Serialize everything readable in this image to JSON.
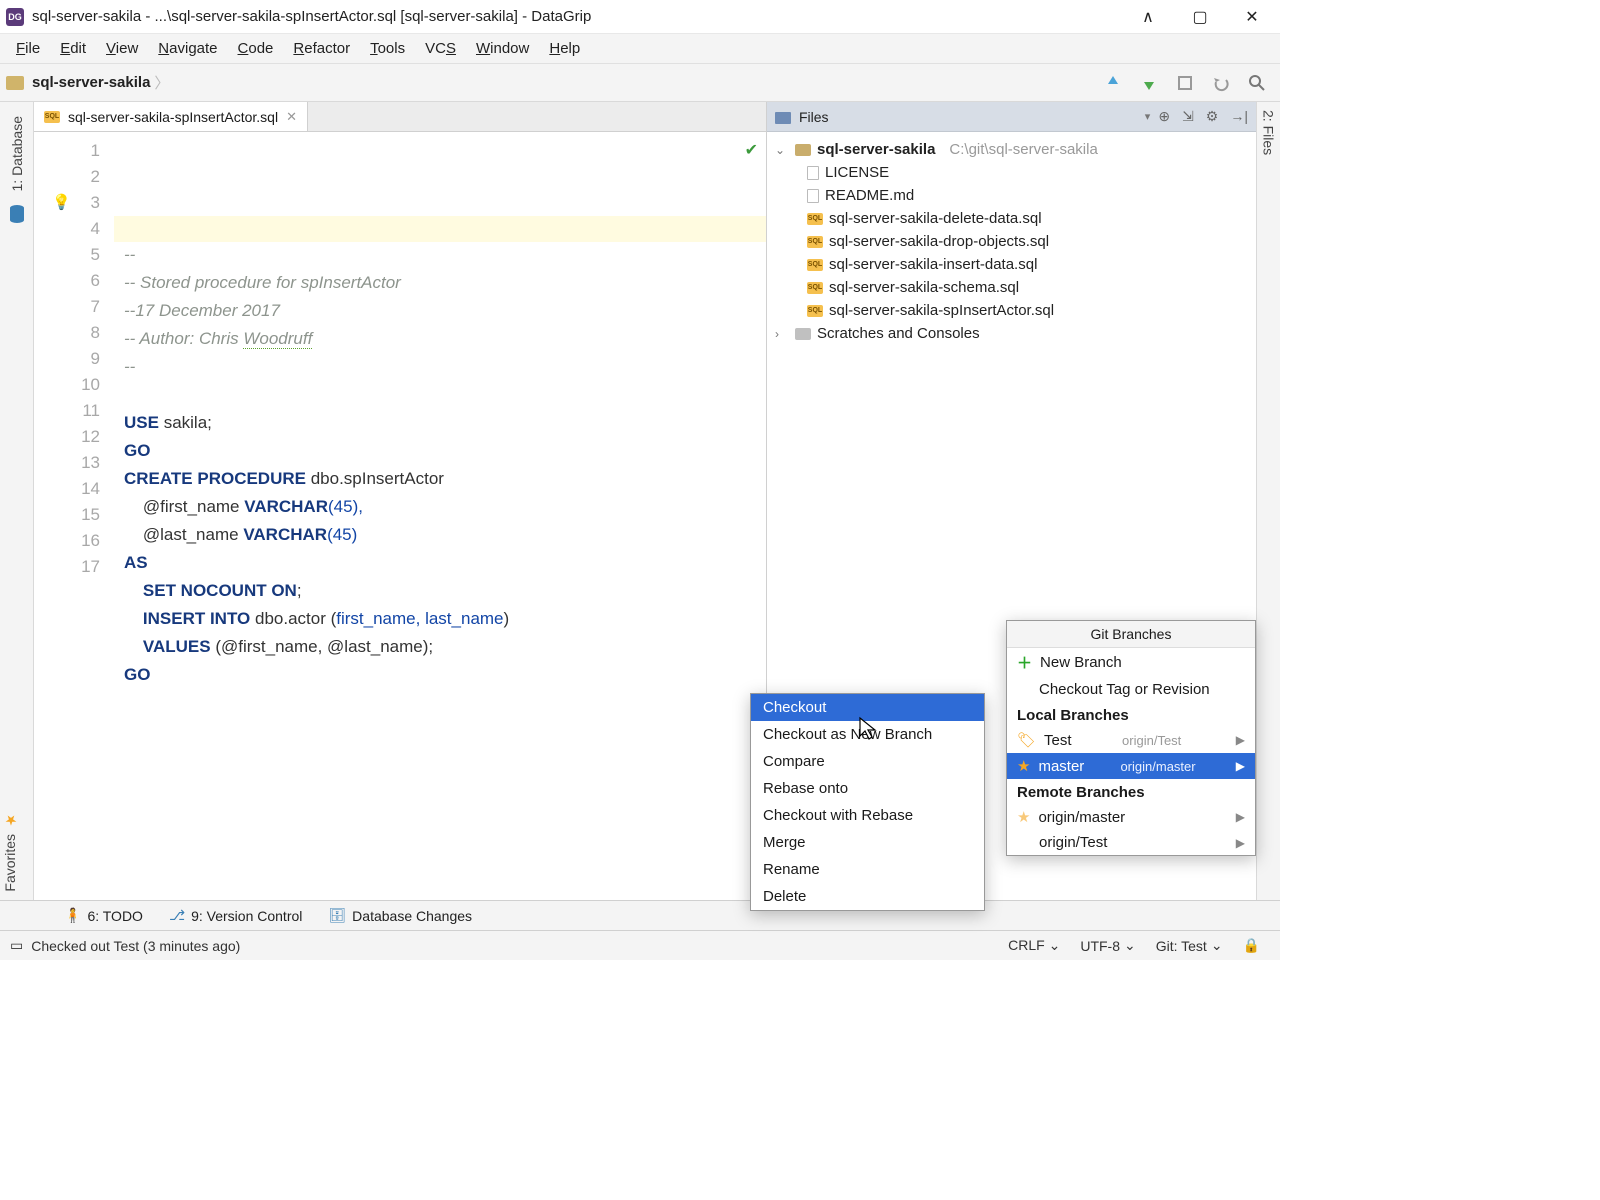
{
  "window": {
    "title": "sql-server-sakila - ...\\sql-server-sakila-spInsertActor.sql [sql-server-sakila] - DataGrip"
  },
  "menu": [
    "File",
    "Edit",
    "View",
    "Navigate",
    "Code",
    "Refactor",
    "Tools",
    "VCS",
    "Window",
    "Help"
  ],
  "breadcrumb": "sql-server-sakila",
  "tab": {
    "name": "sql-server-sakila-spInsertActor.sql"
  },
  "left_sidebar": {
    "database": "1: Database"
  },
  "right_sidebar": {
    "files": "2: Files"
  },
  "favorites": "Favorites",
  "editor": {
    "lines": [
      "1",
      "2",
      "3",
      "4",
      "5",
      "6",
      "7",
      "8",
      "9",
      "10",
      "11",
      "12",
      "13",
      "14",
      "15",
      "16",
      "17"
    ],
    "comment1": "--",
    "comment2": "-- Stored procedure for spInsertActor",
    "comment3_pre": "--",
    "comment3_date": "17 December 2017",
    "comment4_pre": "-- Author: Chris ",
    "comment4_typo": "Woodruff",
    "comment5": "--",
    "l7": {
      "use": "USE",
      "sakila": "sakila;",
      "go": "GO"
    },
    "l9": {
      "create": "CREATE PROCEDURE",
      "name": " dbo.spInsertActor"
    },
    "l10": {
      "p": "    @first_name ",
      "t": "VARCHAR",
      "n": "(45),"
    },
    "l11": {
      "p": "    @last_name ",
      "t": "VARCHAR",
      "n": "(45)"
    },
    "l12": "AS",
    "l13": {
      "set": "    SET NOCOUNT ON",
      ";": ";"
    },
    "l14": {
      "a": "    INSERT INTO",
      " b": " dbo.actor (",
      "c": "first_name, last_name",
      "d": ")"
    },
    "l15": {
      "a": "    VALUES",
      " b": " (@first_name, @last_name);"
    },
    "l16": "GO"
  },
  "files_panel": {
    "label": "Files",
    "root": "sql-server-sakila",
    "root_path": "C:\\git\\sql-server-sakila",
    "items": [
      {
        "icon": "file",
        "name": "LICENSE"
      },
      {
        "icon": "file",
        "name": "README.md"
      },
      {
        "icon": "sql",
        "name": "sql-server-sakila-delete-data.sql"
      },
      {
        "icon": "sql",
        "name": "sql-server-sakila-drop-objects.sql"
      },
      {
        "icon": "sql",
        "name": "sql-server-sakila-insert-data.sql"
      },
      {
        "icon": "sql",
        "name": "sql-server-sakila-schema.sql"
      },
      {
        "icon": "sql",
        "name": "sql-server-sakila-spInsertActor.sql"
      }
    ],
    "scratches": "Scratches and Consoles"
  },
  "bottom_tools": {
    "todo": "6: TODO",
    "vc": "9: Version Control",
    "dbc": "Database Changes"
  },
  "statusbar": {
    "msg": "Checked out Test (3 minutes ago)",
    "enc": "UTF-8",
    "git": "Git: Test"
  },
  "branches_popup": {
    "title": "Git Branches",
    "new_branch": "New Branch",
    "checkout_tag": "Checkout Tag or Revision",
    "local_head": "Local Branches",
    "local": [
      {
        "name": "Test",
        "remote": "origin/Test",
        "star": false
      },
      {
        "name": "master",
        "remote": "origin/master",
        "star": true,
        "selected": true
      }
    ],
    "remote_head": "Remote Branches",
    "remote": [
      {
        "name": "origin/master"
      },
      {
        "name": "origin/Test"
      }
    ]
  },
  "ctx_popup": {
    "items": [
      "Checkout",
      "Checkout as New Branch",
      "Compare",
      "Rebase onto",
      "Checkout with Rebase",
      "Merge",
      "Rename",
      "Delete"
    ],
    "selected": 0
  }
}
